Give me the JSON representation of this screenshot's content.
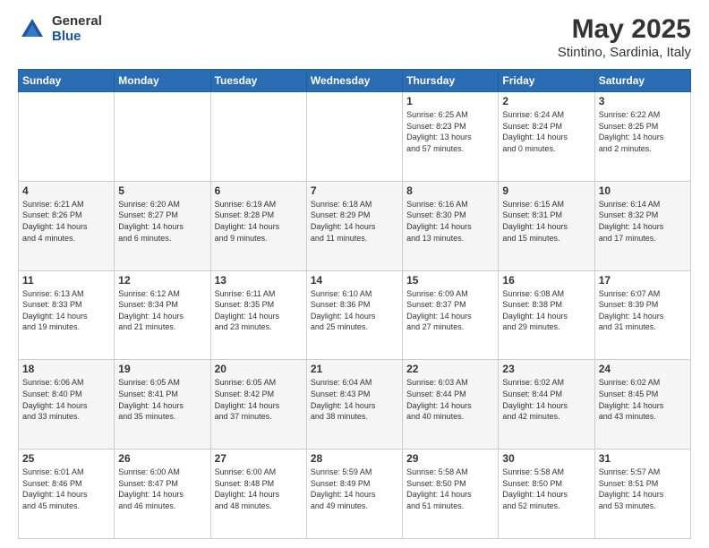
{
  "logo": {
    "general": "General",
    "blue": "Blue"
  },
  "title": "May 2025",
  "subtitle": "Stintino, Sardinia, Italy",
  "days_header": [
    "Sunday",
    "Monday",
    "Tuesday",
    "Wednesday",
    "Thursday",
    "Friday",
    "Saturday"
  ],
  "weeks": [
    [
      {
        "day": "",
        "info": ""
      },
      {
        "day": "",
        "info": ""
      },
      {
        "day": "",
        "info": ""
      },
      {
        "day": "",
        "info": ""
      },
      {
        "day": "1",
        "info": "Sunrise: 6:25 AM\nSunset: 8:23 PM\nDaylight: 13 hours\nand 57 minutes."
      },
      {
        "day": "2",
        "info": "Sunrise: 6:24 AM\nSunset: 8:24 PM\nDaylight: 14 hours\nand 0 minutes."
      },
      {
        "day": "3",
        "info": "Sunrise: 6:22 AM\nSunset: 8:25 PM\nDaylight: 14 hours\nand 2 minutes."
      }
    ],
    [
      {
        "day": "4",
        "info": "Sunrise: 6:21 AM\nSunset: 8:26 PM\nDaylight: 14 hours\nand 4 minutes."
      },
      {
        "day": "5",
        "info": "Sunrise: 6:20 AM\nSunset: 8:27 PM\nDaylight: 14 hours\nand 6 minutes."
      },
      {
        "day": "6",
        "info": "Sunrise: 6:19 AM\nSunset: 8:28 PM\nDaylight: 14 hours\nand 9 minutes."
      },
      {
        "day": "7",
        "info": "Sunrise: 6:18 AM\nSunset: 8:29 PM\nDaylight: 14 hours\nand 11 minutes."
      },
      {
        "day": "8",
        "info": "Sunrise: 6:16 AM\nSunset: 8:30 PM\nDaylight: 14 hours\nand 13 minutes."
      },
      {
        "day": "9",
        "info": "Sunrise: 6:15 AM\nSunset: 8:31 PM\nDaylight: 14 hours\nand 15 minutes."
      },
      {
        "day": "10",
        "info": "Sunrise: 6:14 AM\nSunset: 8:32 PM\nDaylight: 14 hours\nand 17 minutes."
      }
    ],
    [
      {
        "day": "11",
        "info": "Sunrise: 6:13 AM\nSunset: 8:33 PM\nDaylight: 14 hours\nand 19 minutes."
      },
      {
        "day": "12",
        "info": "Sunrise: 6:12 AM\nSunset: 8:34 PM\nDaylight: 14 hours\nand 21 minutes."
      },
      {
        "day": "13",
        "info": "Sunrise: 6:11 AM\nSunset: 8:35 PM\nDaylight: 14 hours\nand 23 minutes."
      },
      {
        "day": "14",
        "info": "Sunrise: 6:10 AM\nSunset: 8:36 PM\nDaylight: 14 hours\nand 25 minutes."
      },
      {
        "day": "15",
        "info": "Sunrise: 6:09 AM\nSunset: 8:37 PM\nDaylight: 14 hours\nand 27 minutes."
      },
      {
        "day": "16",
        "info": "Sunrise: 6:08 AM\nSunset: 8:38 PM\nDaylight: 14 hours\nand 29 minutes."
      },
      {
        "day": "17",
        "info": "Sunrise: 6:07 AM\nSunset: 8:39 PM\nDaylight: 14 hours\nand 31 minutes."
      }
    ],
    [
      {
        "day": "18",
        "info": "Sunrise: 6:06 AM\nSunset: 8:40 PM\nDaylight: 14 hours\nand 33 minutes."
      },
      {
        "day": "19",
        "info": "Sunrise: 6:05 AM\nSunset: 8:41 PM\nDaylight: 14 hours\nand 35 minutes."
      },
      {
        "day": "20",
        "info": "Sunrise: 6:05 AM\nSunset: 8:42 PM\nDaylight: 14 hours\nand 37 minutes."
      },
      {
        "day": "21",
        "info": "Sunrise: 6:04 AM\nSunset: 8:43 PM\nDaylight: 14 hours\nand 38 minutes."
      },
      {
        "day": "22",
        "info": "Sunrise: 6:03 AM\nSunset: 8:44 PM\nDaylight: 14 hours\nand 40 minutes."
      },
      {
        "day": "23",
        "info": "Sunrise: 6:02 AM\nSunset: 8:44 PM\nDaylight: 14 hours\nand 42 minutes."
      },
      {
        "day": "24",
        "info": "Sunrise: 6:02 AM\nSunset: 8:45 PM\nDaylight: 14 hours\nand 43 minutes."
      }
    ],
    [
      {
        "day": "25",
        "info": "Sunrise: 6:01 AM\nSunset: 8:46 PM\nDaylight: 14 hours\nand 45 minutes."
      },
      {
        "day": "26",
        "info": "Sunrise: 6:00 AM\nSunset: 8:47 PM\nDaylight: 14 hours\nand 46 minutes."
      },
      {
        "day": "27",
        "info": "Sunrise: 6:00 AM\nSunset: 8:48 PM\nDaylight: 14 hours\nand 48 minutes."
      },
      {
        "day": "28",
        "info": "Sunrise: 5:59 AM\nSunset: 8:49 PM\nDaylight: 14 hours\nand 49 minutes."
      },
      {
        "day": "29",
        "info": "Sunrise: 5:58 AM\nSunset: 8:50 PM\nDaylight: 14 hours\nand 51 minutes."
      },
      {
        "day": "30",
        "info": "Sunrise: 5:58 AM\nSunset: 8:50 PM\nDaylight: 14 hours\nand 52 minutes."
      },
      {
        "day": "31",
        "info": "Sunrise: 5:57 AM\nSunset: 8:51 PM\nDaylight: 14 hours\nand 53 minutes."
      }
    ]
  ]
}
